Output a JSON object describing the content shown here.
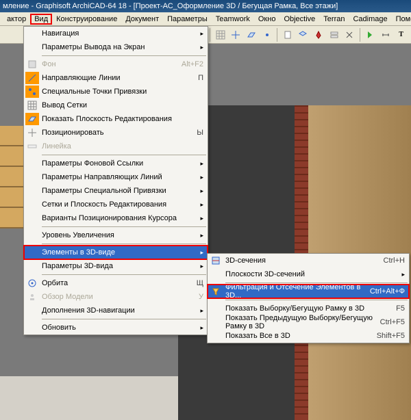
{
  "title": "мление - Graphisoft ArchiCAD-64 18 - [Проект-АС_Оформление 3D / Бегущая Рамка, Все этажи]",
  "menubar": [
    "актор",
    "Вид",
    "Конструирование",
    "Документ",
    "Параметры",
    "Teamwork",
    "Окно",
    "Objective",
    "Terran",
    "Cadimage",
    "Помощь"
  ],
  "menu": {
    "nav": {
      "label": "Навигация"
    },
    "disp": {
      "label": "Параметры Вывода на Экран"
    },
    "bg": {
      "label": "Фон",
      "short": "Alt+F2"
    },
    "guide": {
      "label": "Направляющие Линии",
      "short": "П"
    },
    "snap": {
      "label": "Специальные Точки Привязки"
    },
    "grid": {
      "label": "Вывод Сетки"
    },
    "plane": {
      "label": "Показать Плоскость Редактирования"
    },
    "pos": {
      "label": "Позиционировать",
      "short": "Ы"
    },
    "ruler": {
      "label": "Линейка"
    },
    "tref": {
      "label": "Параметры Фоновой Ссылки"
    },
    "tguide": {
      "label": "Параметры Направляющих Линий"
    },
    "tsnap": {
      "label": "Параметры Специальной Привязки"
    },
    "tgrid": {
      "label": "Сетки и Плоскость Редактирования"
    },
    "tcur": {
      "label": "Варианты Позиционирования Курсора"
    },
    "zoom": {
      "label": "Уровень Увеличения"
    },
    "elem3d": {
      "label": "Элементы в 3D-виде"
    },
    "p3d": {
      "label": "Параметры 3D-вида"
    },
    "orbit": {
      "label": "Орбита",
      "short": "Щ"
    },
    "browse": {
      "label": "Обзор Модели",
      "short": "У"
    },
    "add3d": {
      "label": "Дополнения 3D-навигации"
    },
    "refresh": {
      "label": "Обновить"
    }
  },
  "submenu": {
    "sec": {
      "label": "3D-сечения",
      "short": "Ctrl+H"
    },
    "planes": {
      "label": "Плоскости 3D-сечений"
    },
    "filter": {
      "label": "Фильтрация и Отсечение Элементов в 3D...",
      "short": "Ctrl+Alt+Ф"
    },
    "showsel": {
      "label": "Показать Выборку/Бегущую Рамку в 3D",
      "short": "F5"
    },
    "showprev": {
      "label": "Показать Предыдущую Выборку/Бегущую Рамку в 3D",
      "short": "Ctrl+F5"
    },
    "showall": {
      "label": "Показать Все в 3D",
      "short": "Shift+F5"
    }
  }
}
